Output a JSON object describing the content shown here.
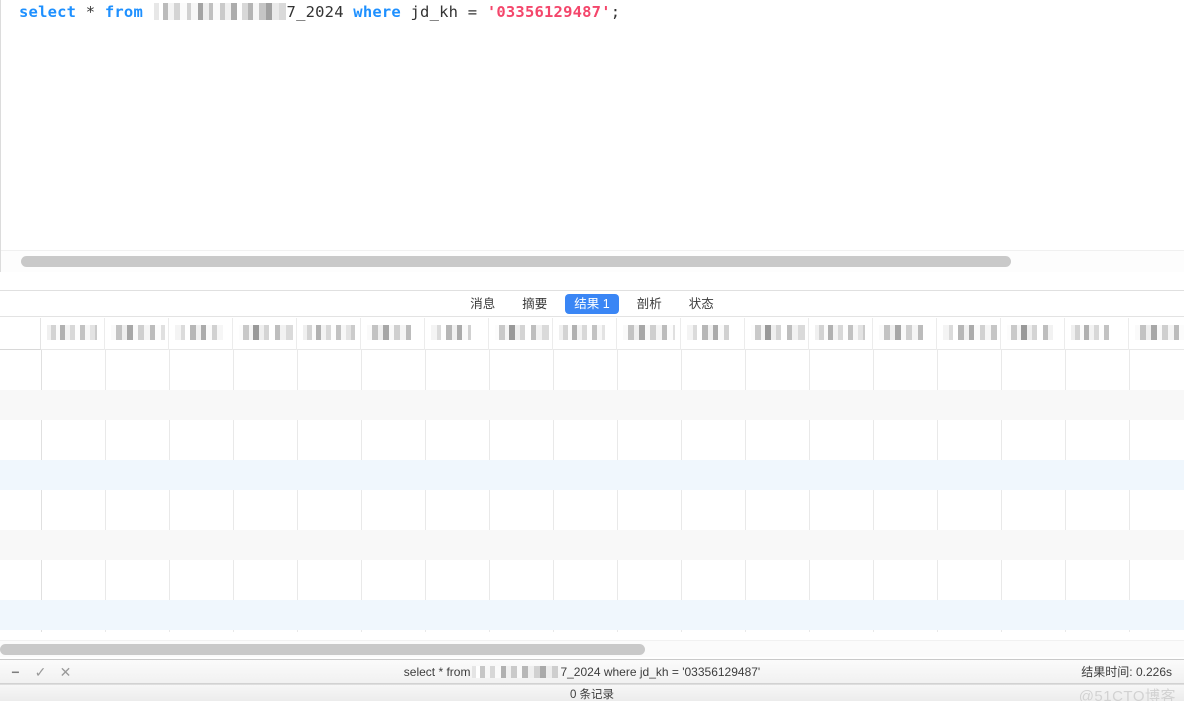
{
  "editor": {
    "sql_tokens": [
      {
        "text": "select",
        "type": "keyword"
      },
      {
        "text": "*",
        "type": "operator"
      },
      {
        "text": "from",
        "type": "keyword"
      },
      {
        "text": "[REDACTED]",
        "type": "redacted"
      },
      {
        "text": "7_2024",
        "type": "identifier"
      },
      {
        "text": "where",
        "type": "keyword"
      },
      {
        "text": "jd_kh",
        "type": "identifier"
      },
      {
        "text": "=",
        "type": "operator"
      },
      {
        "text": "'03356129487'",
        "type": "string"
      },
      {
        "text": ";",
        "type": "punctuation"
      }
    ],
    "keyword_select": "select",
    "star": "*",
    "keyword_from": "from",
    "table_suffix": "7_2024",
    "keyword_where": "where",
    "column_name": "jd_kh",
    "equals": "=",
    "string_literal": "'03356129487'",
    "semicolon": ";",
    "colors": {
      "keyword": "#1e90ff",
      "string": "#f4466b",
      "identifier": "#333333"
    }
  },
  "tabs": [
    {
      "label": "消息",
      "active": false
    },
    {
      "label": "摘要",
      "active": false
    },
    {
      "label": "结果 1",
      "active": true
    },
    {
      "label": "剖析",
      "active": false
    },
    {
      "label": "状态",
      "active": false
    }
  ],
  "grid": {
    "columns": [
      {
        "label": "[REDACTED]",
        "redacted": true,
        "width": 64
      },
      {
        "label": "[REDACTED]",
        "redacted": true,
        "width": 64
      },
      {
        "label": "[REDACTED]",
        "redacted": true,
        "width": 64
      },
      {
        "label": "[REDACTED]",
        "redacted": true,
        "width": 64
      },
      {
        "label": "[REDACTED]",
        "redacted": true,
        "width": 64
      },
      {
        "label": "[REDACTED]",
        "redacted": true,
        "width": 64
      },
      {
        "label": "[REDACTED]",
        "redacted": true,
        "width": 64
      },
      {
        "label": "[REDACTED]",
        "redacted": true,
        "width": 64
      },
      {
        "label": "[REDACTED]",
        "redacted": true,
        "width": 64
      },
      {
        "label": "[REDACTED]",
        "redacted": true,
        "width": 64
      },
      {
        "label": "[REDACTED]",
        "redacted": true,
        "width": 64
      },
      {
        "label": "[REDACTED]",
        "redacted": true,
        "width": 64
      },
      {
        "label": "[REDACTED]",
        "redacted": true,
        "width": 64
      },
      {
        "label": "[REDACTED]",
        "redacted": true,
        "width": 64
      },
      {
        "label": "[REDACTED]",
        "redacted": true,
        "width": 64
      },
      {
        "label": "[REDACTED]",
        "redacted": true,
        "width": 64
      },
      {
        "label": "[REDACTED]",
        "redacted": true,
        "width": 64
      },
      {
        "label": "[REDACTED]",
        "redacted": true,
        "width": 64
      }
    ],
    "rows": [],
    "row_count": 0,
    "accent_selected_row": "#f0f7fd",
    "accent_alt_row": "#f8f8f8"
  },
  "statusbar": {
    "icon_collapse": "−",
    "icon_commit": "✓",
    "icon_rollback": "✕",
    "sql_prefix": "select * from",
    "sql_redacted": "[REDACTED]",
    "sql_suffix": "7_2024 where jd_kh = '03356129487'",
    "result_time_label": "结果时间: 0.226s"
  },
  "recordbar": {
    "record_count_label": "0 条记录",
    "watermark": "@51CTO博客"
  },
  "scrollbars": {
    "editor_thumb_label": "editor-horizontal-scrollbar",
    "grid_thumb_label": "grid-horizontal-scrollbar"
  }
}
